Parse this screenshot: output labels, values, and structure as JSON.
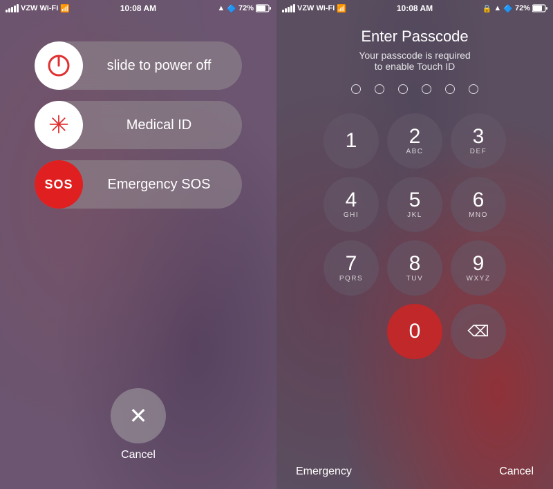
{
  "left": {
    "status": {
      "carrier": "VZW Wi-Fi",
      "time": "10:08 AM",
      "battery": "72%"
    },
    "slide_button": {
      "label": "slide to power off"
    },
    "medical_button": {
      "label": "Medical ID"
    },
    "sos_button": {
      "icon_text": "SOS",
      "label": "Emergency SOS"
    },
    "cancel": {
      "label": "Cancel"
    }
  },
  "right": {
    "status": {
      "carrier": "VZW Wi-Fi",
      "time": "10:08 AM",
      "battery": "72%"
    },
    "title": "Enter Passcode",
    "subtitle_line1": "Your passcode is required",
    "subtitle_line2": "to enable Touch ID",
    "dots": 6,
    "numpad": [
      {
        "main": "1",
        "sub": ""
      },
      {
        "main": "2",
        "sub": "ABC"
      },
      {
        "main": "3",
        "sub": "DEF"
      },
      {
        "main": "4",
        "sub": "GHI"
      },
      {
        "main": "5",
        "sub": "JKL"
      },
      {
        "main": "6",
        "sub": "MNO"
      },
      {
        "main": "7",
        "sub": "PQRS"
      },
      {
        "main": "8",
        "sub": "TUV"
      },
      {
        "main": "9",
        "sub": "WXYZ"
      },
      {
        "main": "",
        "sub": ""
      },
      {
        "main": "0",
        "sub": ""
      },
      {
        "main": "⌫",
        "sub": ""
      }
    ],
    "bottom_left": "Emergency",
    "bottom_right": "Cancel"
  }
}
